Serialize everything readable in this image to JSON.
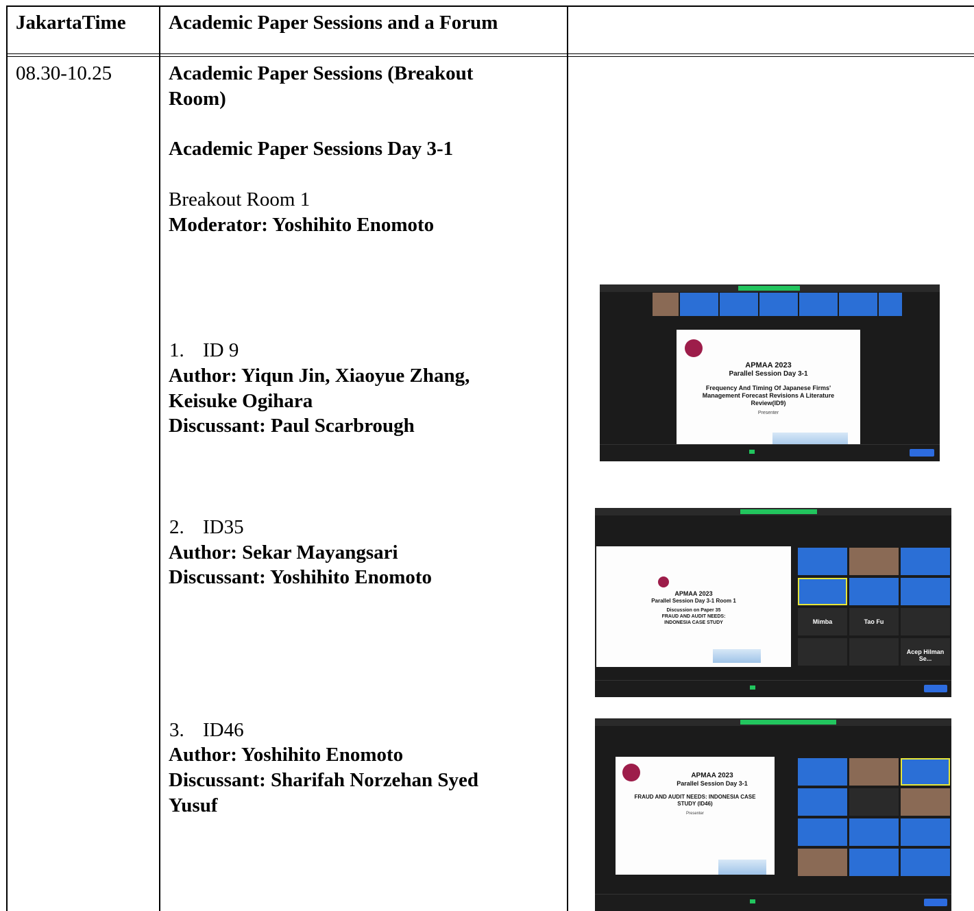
{
  "header": {
    "time_col": "JakartaTime",
    "title_col": "Academic Paper Sessions and a Forum"
  },
  "row": {
    "time": "08.30-10.25",
    "session_title_line1": "Academic Paper Sessions (Breakout",
    "session_title_line2": "Room)",
    "day_title": "Academic Paper Sessions Day 3-1",
    "room": "Breakout Room 1",
    "moderator": "Moderator: Yoshihito Enomoto",
    "papers": [
      {
        "number": "1.",
        "id": "ID 9",
        "author_line1": "Author: Yiqun Jin, Xiaoyue Zhang,",
        "author_line2": "Keisuke Ogihara",
        "discussant": "Discussant: Paul Scarbrough"
      },
      {
        "number": "2.",
        "id": "ID35",
        "author_line1": "Author: Sekar Mayangsari",
        "discussant": "Discussant: Yoshihito Enomoto"
      },
      {
        "number": "3.",
        "id": "ID46",
        "author_line1": "Author: Yoshihito Enomoto",
        "discussant_line1": "Discussant: Sharifah Norzehan Syed",
        "discussant_line2": "Yusuf"
      }
    ]
  },
  "screenshots": [
    {
      "slide_title": "APMAA 2023",
      "slide_subtitle": "Parallel Session Day 3-1",
      "slide_paper_line1": "Frequency And Timing Of Japanese Firms'",
      "slide_paper_line2": "Management Forecast Revisions A Literature",
      "slide_paper_line3": "Review(ID9)",
      "slide_presenter": "Presenter"
    },
    {
      "slide_title": "APMAA 2023",
      "slide_subtitle": "Parallel Session Day 3-1 Room 1",
      "slide_paper_line1": "Discussion on Paper 35",
      "slide_paper_line2": "FRAUD AND AUDIT NEEDS:",
      "slide_paper_line3": "INDONESIA CASE STUDY",
      "tile_labels": [
        "Mimba",
        "Tao Fu",
        "Acep Hilman Se..."
      ]
    },
    {
      "slide_title": "APMAA 2023",
      "slide_subtitle": "Parallel Session Day 3-1",
      "slide_paper_line1": "FRAUD AND AUDIT NEEDS: INDONESIA CASE",
      "slide_paper_line2": "STUDY (ID46)",
      "slide_presenter": "Presenter"
    }
  ],
  "colors": {
    "accent_green": "#22c55e",
    "tile_blue": "#2b6fd6",
    "logo": "#9d1d4a"
  }
}
